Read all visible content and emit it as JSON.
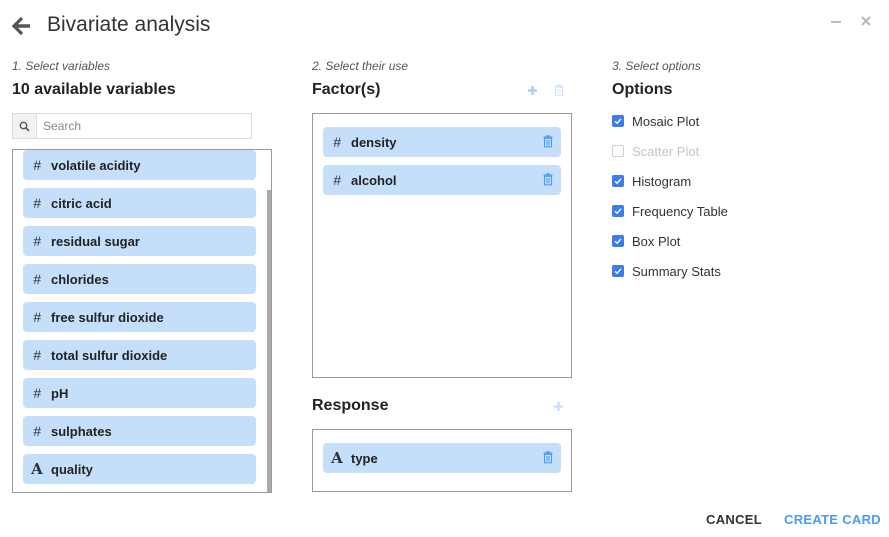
{
  "dialog": {
    "title": "Bivariate analysis"
  },
  "colors": {
    "accent": "#4a9af5",
    "chip_bg": "#c5dffb",
    "checkbox": "#3e7bec"
  },
  "variables_panel": {
    "step": "1. Select variables",
    "heading": "10 available variables",
    "search_placeholder": "Search",
    "search_value": "",
    "items": [
      {
        "type": "numeric",
        "type_glyph": "#",
        "label": "volatile acidity"
      },
      {
        "type": "numeric",
        "type_glyph": "#",
        "label": "citric acid"
      },
      {
        "type": "numeric",
        "type_glyph": "#",
        "label": "residual sugar"
      },
      {
        "type": "numeric",
        "type_glyph": "#",
        "label": "chlorides"
      },
      {
        "type": "numeric",
        "type_glyph": "#",
        "label": "free sulfur dioxide"
      },
      {
        "type": "numeric",
        "type_glyph": "#",
        "label": "total sulfur dioxide"
      },
      {
        "type": "numeric",
        "type_glyph": "#",
        "label": "pH"
      },
      {
        "type": "numeric",
        "type_glyph": "#",
        "label": "sulphates"
      },
      {
        "type": "categorical",
        "type_glyph": "A",
        "label": "quality"
      }
    ]
  },
  "use_panel": {
    "step": "2. Select their use",
    "factors": {
      "heading": "Factor(s)",
      "items": [
        {
          "type": "numeric",
          "type_glyph": "#",
          "label": "density"
        },
        {
          "type": "numeric",
          "type_glyph": "#",
          "label": "alcohol"
        }
      ]
    },
    "response": {
      "heading": "Response",
      "items": [
        {
          "type": "categorical",
          "type_glyph": "A",
          "label": "type"
        }
      ]
    }
  },
  "options_panel": {
    "step": "3. Select options",
    "heading": "Options",
    "items": [
      {
        "label": "Mosaic Plot",
        "checked": true,
        "disabled": false
      },
      {
        "label": "Scatter Plot",
        "checked": false,
        "disabled": true
      },
      {
        "label": "Histogram",
        "checked": true,
        "disabled": false
      },
      {
        "label": "Frequency Table",
        "checked": true,
        "disabled": false
      },
      {
        "label": "Box Plot",
        "checked": true,
        "disabled": false
      },
      {
        "label": "Summary Stats",
        "checked": true,
        "disabled": false
      }
    ]
  },
  "footer": {
    "cancel_label": "CANCEL",
    "create_label": "CREATE CARD"
  }
}
